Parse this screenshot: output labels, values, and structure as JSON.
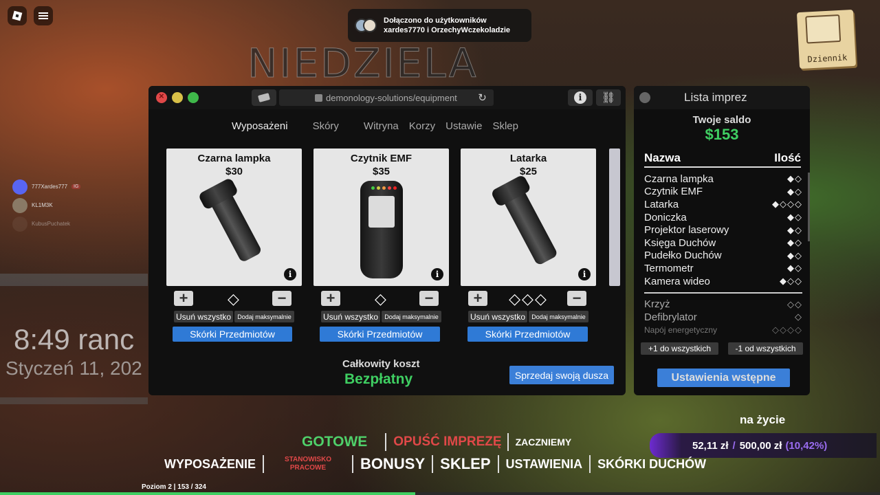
{
  "notification": {
    "line1": "Dołączono do użytkowników",
    "line2": "xardes7770 i OrzechyWczekoladzie"
  },
  "scene": {
    "day": "NIEDZIELA",
    "time": "8:49 ranc",
    "date": "Styczeń 11, 202"
  },
  "journal": {
    "label": "Dziennik"
  },
  "voice": [
    {
      "name": "777Xardes777",
      "badge": "IG"
    },
    {
      "name": "KL1M3K",
      "badge": ""
    },
    {
      "name": "KubusPuchatek",
      "badge": ""
    }
  ],
  "browser": {
    "url": "demonology-solutions/equipment",
    "tabs": [
      "Wyposażeni",
      "Skóry",
      "Witryna",
      "Korzy",
      "Ustawie",
      "Sklep"
    ],
    "items": [
      {
        "name": "Czarna lampka",
        "price": "$30",
        "icon": "flashlight-icon",
        "count_display": "◇",
        "remove_all": "Usuń wszystko",
        "add_max": "Dodaj maksymalnie",
        "skins": "Skórki Przedmiotów"
      },
      {
        "name": "Czytnik EMF",
        "price": "$35",
        "icon": "emf-reader-icon",
        "count_display": "◇",
        "remove_all": "Usuń wszystko",
        "add_max": "Dodaj maksymalnie",
        "skins": "Skórki Przedmiotów"
      },
      {
        "name": "Latarka",
        "price": "$25",
        "icon": "flashlight-icon",
        "count_display": "◇◇◇",
        "remove_all": "Usuń wszystko",
        "add_max": "Dodaj maksymalnie",
        "skins": "Skórki Przedmiotów"
      }
    ],
    "total_label": "Całkowity koszt",
    "total_value": "Bezpłatny",
    "sell_label": "Sprzedaj swoją dusza"
  },
  "party_panel": {
    "title": "Lista imprez",
    "balance_label": "Twoje saldo",
    "balance": "$153",
    "col_name": "Nazwa",
    "col_qty": "Ilość",
    "items": [
      {
        "name": "Czarna lampka",
        "qty": "◆◇"
      },
      {
        "name": "Czytnik EMF",
        "qty": "◆◇"
      },
      {
        "name": "Latarka",
        "qty": "◆◇◇◇"
      },
      {
        "name": "Doniczka",
        "qty": "◆◇"
      },
      {
        "name": "Projektor laserowy",
        "qty": "◆◇"
      },
      {
        "name": "Księga Duchów",
        "qty": "◆◇"
      },
      {
        "name": "Pudełko Duchów",
        "qty": "◆◇"
      },
      {
        "name": "Termometr",
        "qty": "◆◇"
      },
      {
        "name": "Kamera wideo",
        "qty": "◆◇◇"
      }
    ],
    "extra_items": [
      {
        "name": "Krzyż",
        "qty": "◇◇"
      },
      {
        "name": "Defibrylator",
        "qty": "◇"
      },
      {
        "name": "Napój energetyczny",
        "qty": "◇◇◇◇"
      }
    ],
    "plus_all": "+1 do wszystkich",
    "minus_all": "-1 od wszystkich",
    "presets": "Ustawienia wstępne"
  },
  "hud": {
    "na_zycie": "na życie",
    "money_current": "52,11 zł",
    "money_goal": "500,00 zł",
    "money_pct": "(10,42%)",
    "ready": "GOTOWE",
    "leave": "OPUŚĆ IMPREZĘ",
    "start": "ZACZNIEMY",
    "nav": [
      "WYPOSAŻENIE",
      "STANOWISKO PRACOWE",
      "BONUSY",
      "SKLEP",
      "USTAWIENIA",
      "SKÓRKI DUCHÓW"
    ],
    "level": "Poziom 2 | 153 / 324",
    "xp_fraction": 0.472
  }
}
